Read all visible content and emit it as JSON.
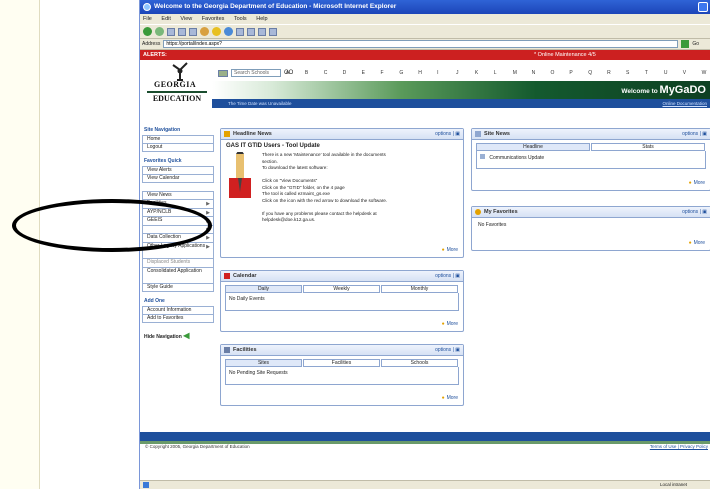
{
  "window": {
    "title": "Welcome to the Georgia Department of Education - Microsoft Internet Explorer"
  },
  "menu": [
    "File",
    "Edit",
    "View",
    "Favorites",
    "Tools",
    "Help"
  ],
  "address": {
    "label": "Address",
    "url": "https://portal/index.aspx?",
    "go": "Go"
  },
  "alert": {
    "label": "ALERTS:",
    "maintenance": "* Online Maintenance 4/5"
  },
  "logo": {
    "state": "GEORGIA",
    "dept": "EDUCATION"
  },
  "search": {
    "placeholder": "Search Schools",
    "go": "GO"
  },
  "letters": [
    "A",
    "B",
    "C",
    "D",
    "E",
    "F",
    "G",
    "H",
    "I",
    "J",
    "K",
    "L",
    "M",
    "N",
    "O",
    "P",
    "Q",
    "R",
    "S",
    "T",
    "U",
    "V",
    "W",
    "X",
    "Y",
    "Z"
  ],
  "banner": {
    "welcome": "Welcome to",
    "brand": "MyGaDO"
  },
  "bluebar": {
    "time": "The Time Date was Unavailable",
    "help": "Online Documentation"
  },
  "sidebar": {
    "nav_heading": "Site Navigation",
    "nav": [
      "Home",
      "Logout"
    ],
    "fav_heading": "Favorites Quick",
    "fav": [
      "View Alerts",
      "View Calendar"
    ],
    "tools": [
      "View News",
      "Facilities",
      "AYP/NCLB",
      "GEEIS",
      "",
      "Data Collection",
      "Other Legacy Applications",
      "Displaced Students",
      "Consolidated Application",
      "Style Guide"
    ],
    "add_heading": "Add One",
    "add": [
      "Account Information",
      "Add to Favorites"
    ],
    "hide": "Hide Navigation"
  },
  "headline": {
    "title": "Headline News",
    "options": "options | ▣",
    "heading": "GAS IT GTID Users - Tool Update",
    "lines": [
      "There is a new 'Maintenance' tool available in the documents",
      "section.",
      "To download the latest software:",
      "",
      "Click on \"View Documents\"",
      "Click on the \"GTID\" folder, on the 4 page",
      "The tool is called ezmaint_gs.exe",
      "Click on the icon with the red arrow to download the software.",
      "",
      "If you have any problems please contact the helpdesk at",
      "helpdesk@doe.k12.ga.us."
    ],
    "more": "More"
  },
  "sitenews": {
    "title": "Site News",
    "options": "options | ▣",
    "tabs": [
      "Headline",
      "Stats"
    ],
    "item": "Communications Update",
    "more": "More"
  },
  "favorites": {
    "title": "My Favorites",
    "options": "options | ▣",
    "empty": "No Favorites",
    "more": "More"
  },
  "calendar": {
    "title": "Calendar",
    "options": "options | ▣",
    "tabs": [
      "Daily",
      "Weekly",
      "Monthly"
    ],
    "empty": "No Daily Events",
    "more": "More"
  },
  "facilities": {
    "title": "Facilities",
    "options": "options | ▣",
    "tabs": [
      "Sites",
      "Facilities",
      "Schools"
    ],
    "empty": "No Pending Site Requests",
    "more": "More"
  },
  "footer": {
    "copyright": "© Copyright 2005, Georgia Department of Education",
    "terms": "Terms of Use | Privacy Policy"
  },
  "status": {
    "zone": "Local intranet"
  }
}
